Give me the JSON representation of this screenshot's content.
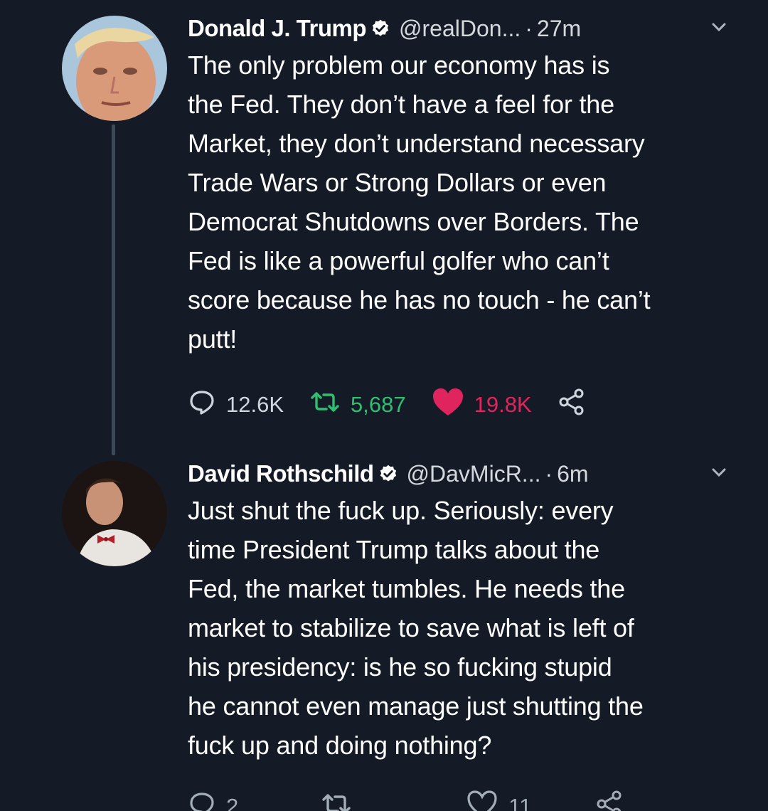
{
  "tweets": [
    {
      "name": "Donald J. Trump",
      "handle": "@realDon...",
      "time": "27m",
      "text": "The only problem our economy has is\nthe Fed. They don’t have a feel for the\nMarket, they don’t understand necessary\nTrade Wars or Strong Dollars or even\nDemocrat Shutdowns over Borders. The\nFed is like a powerful golfer who can’t\nscore because he has no touch - he can’t\nputt!",
      "replies": "12.6K",
      "retweets": "5,687",
      "likes": "19.8K",
      "liked": true,
      "retweeted": true
    },
    {
      "name": "David Rothschild",
      "handle": "@DavMicR...",
      "time": "6m",
      "text": "Just shut the fuck up. Seriously: every\ntime President Trump talks about the\nFed, the market tumbles. He needs the\nmarket to stabilize to save what is left of\nhis presidency: is he so fucking stupid\nhe cannot even manage just shutting the\nfuck up and doing nothing?",
      "replies": "2",
      "retweets": "",
      "likes": "11",
      "liked": false,
      "retweeted": false
    }
  ],
  "separator": "·",
  "colors": {
    "background": "#151b26",
    "verified": "#ffffff",
    "retweet": "#2fbf71",
    "like": "#e0245e"
  },
  "icons": [
    "verified-icon",
    "chevron-down-icon",
    "reply-icon",
    "retweet-icon",
    "like-icon",
    "share-icon"
  ]
}
